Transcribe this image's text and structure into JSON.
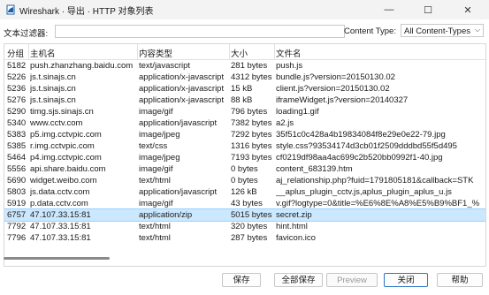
{
  "window": {
    "title": "Wireshark · 导出 · HTTP 对象列表",
    "min_glyph": "—",
    "max_glyph": "☐",
    "close_glyph": "✕"
  },
  "filter": {
    "label": "文本过滤器:",
    "value": "",
    "content_type_label": "Content Type:",
    "content_type_value": "All Content-Types"
  },
  "table": {
    "columns": [
      "分组",
      "主机名",
      "内容类型",
      "大小",
      "文件名"
    ],
    "rows": [
      {
        "packet": "5182",
        "host": "push.zhanzhang.baidu.com",
        "type": "text/javascript",
        "size": "281 bytes",
        "filename": "push.js"
      },
      {
        "packet": "5226",
        "host": "js.t.sinajs.cn",
        "type": "application/x-javascript",
        "size": "4312 bytes",
        "filename": "bundle.js?version=20150130.02"
      },
      {
        "packet": "5236",
        "host": "js.t.sinajs.cn",
        "type": "application/x-javascript",
        "size": "15 kB",
        "filename": "client.js?version=20150130.02"
      },
      {
        "packet": "5276",
        "host": "js.t.sinajs.cn",
        "type": "application/x-javascript",
        "size": "88 kB",
        "filename": "iframeWidget.js?version=20140327"
      },
      {
        "packet": "5290",
        "host": "timg.sjs.sinajs.cn",
        "type": "image/gif",
        "size": "796 bytes",
        "filename": "loading1.gif"
      },
      {
        "packet": "5340",
        "host": "www.cctv.com",
        "type": "application/javascript",
        "size": "7382 bytes",
        "filename": "a2.js"
      },
      {
        "packet": "5383",
        "host": "p5.img.cctvpic.com",
        "type": "image/jpeg",
        "size": "7292 bytes",
        "filename": "35f51c0c428a4b19834084f8e29e0e22-79.jpg"
      },
      {
        "packet": "5385",
        "host": "r.img.cctvpic.com",
        "type": "text/css",
        "size": "1316 bytes",
        "filename": "style.css?93534174d3cb01f2509dddbd55f5d495"
      },
      {
        "packet": "5464",
        "host": "p4.img.cctvpic.com",
        "type": "image/jpeg",
        "size": "7193 bytes",
        "filename": "cf0219df98aa4ac699c2b520bb0992f1-40.jpg"
      },
      {
        "packet": "5556",
        "host": "api.share.baidu.com",
        "type": "image/gif",
        "size": "0 bytes",
        "filename": "content_683139.htm"
      },
      {
        "packet": "5690",
        "host": "widget.weibo.com",
        "type": "text/html",
        "size": "0 bytes",
        "filename": "aj_relationship.php?fuid=1791805181&callback=STK"
      },
      {
        "packet": "5803",
        "host": "js.data.cctv.com",
        "type": "application/javascript",
        "size": "126 kB",
        "filename": "__aplus_plugin_cctv.js,aplus_plugin_aplus_u.js"
      },
      {
        "packet": "5919",
        "host": "p.data.cctv.com",
        "type": "image/gif",
        "size": "43 bytes",
        "filename": "v.gif?logtype=0&title=%E6%8E%A8%E5%B9%BF1_%"
      },
      {
        "packet": "6757",
        "host": "47.107.33.15:81",
        "type": "application/zip",
        "size": "5015 bytes",
        "filename": "secret.zip"
      },
      {
        "packet": "7792",
        "host": "47.107.33.15:81",
        "type": "text/html",
        "size": "320 bytes",
        "filename": "hint.html"
      },
      {
        "packet": "7796",
        "host": "47.107.33.15:81",
        "type": "text/html",
        "size": "287 bytes",
        "filename": "favicon.ico"
      }
    ],
    "selected_packet": "6757"
  },
  "buttons": {
    "save": "保存",
    "save_all": "全部保存",
    "preview": "Preview",
    "close": "关闭",
    "help": "帮助"
  },
  "colors": {
    "selection": "#cce8ff",
    "accent": "#2f74c8",
    "app_icon": "#1f5fa8"
  }
}
